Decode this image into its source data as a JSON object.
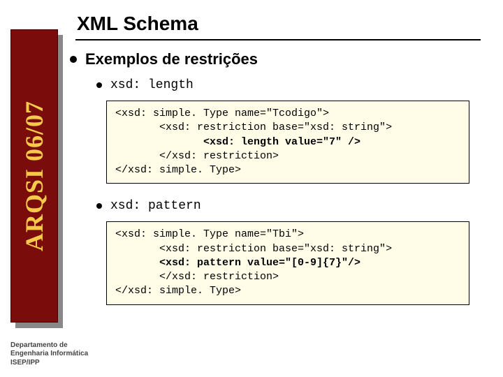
{
  "sidebar": {
    "label": "ARQSI 06/07"
  },
  "title": "XML Schema",
  "heading": "Exemplos de restrições",
  "item1": {
    "label": "xsd: length",
    "code_l1": "<xsd: simple. Type name=\"Tcodigo\">",
    "code_l2": "       <xsd: restriction base=\"xsd: string\">",
    "code_l3": "              <xsd: length value=\"7\" />",
    "code_l4": "       </xsd: restriction>",
    "code_l5": "</xsd: simple. Type>"
  },
  "item2": {
    "label": "xsd: pattern",
    "code_l1": "<xsd: simple. Type name=\"Tbi\">",
    "code_l2": "       <xsd: restriction base=\"xsd: string\">",
    "code_l3": "       <xsd: pattern value=\"[0-9]{7}\"/>",
    "code_l4": "       </xsd: restriction>",
    "code_l5": "</xsd: simple. Type>"
  },
  "footer": {
    "l1": "Departamento de",
    "l2": "Engenharia Informática",
    "l3": "ISEP/IPP"
  }
}
